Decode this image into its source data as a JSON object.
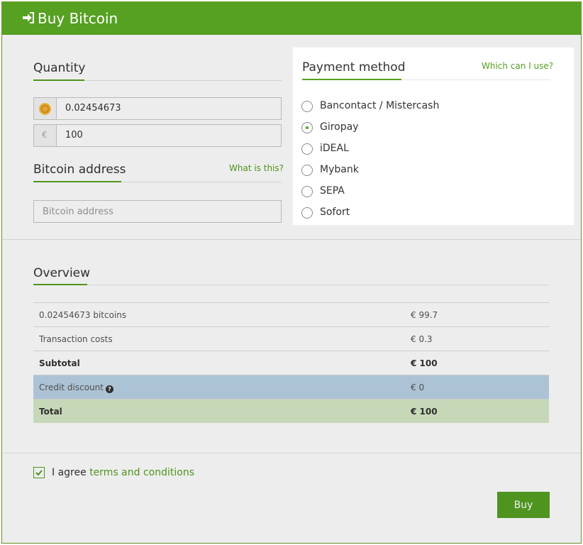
{
  "header": {
    "title": "Buy Bitcoin",
    "icon": "sign-in-icon"
  },
  "quantity": {
    "title": "Quantity",
    "btc_value": "0.02454673",
    "euro_symbol": "€",
    "euro_value": "100"
  },
  "address": {
    "title": "Bitcoin address",
    "help_link": "What is this?",
    "placeholder": "Bitcoin address"
  },
  "payment": {
    "title": "Payment method",
    "help_link": "Which can I use?",
    "selected": "Giropay",
    "options": [
      {
        "label": "Bancontact / Mistercash",
        "checked": false
      },
      {
        "label": "Giropay",
        "checked": true
      },
      {
        "label": "iDEAL",
        "checked": false
      },
      {
        "label": "Mybank",
        "checked": false
      },
      {
        "label": "SEPA",
        "checked": false
      },
      {
        "label": "Sofort",
        "checked": false
      }
    ]
  },
  "overview": {
    "title": "Overview",
    "rows": [
      {
        "label": "0.02454673 bitcoins",
        "value": "€ 99.7"
      },
      {
        "label": "Transaction costs",
        "value": "€ 0.3"
      },
      {
        "label": "Subtotal",
        "value": "€ 100"
      },
      {
        "label": "Credit discount",
        "value": "€ 0"
      },
      {
        "label": "Total",
        "value": "€ 100"
      }
    ]
  },
  "terms": {
    "prefix": "I agree",
    "link": "terms and conditions",
    "checked": true
  },
  "actions": {
    "buy_label": "Buy"
  },
  "colors": {
    "accent": "#56a022",
    "discount_row": "#bad2e6",
    "total_row": "#d6e9c6"
  }
}
